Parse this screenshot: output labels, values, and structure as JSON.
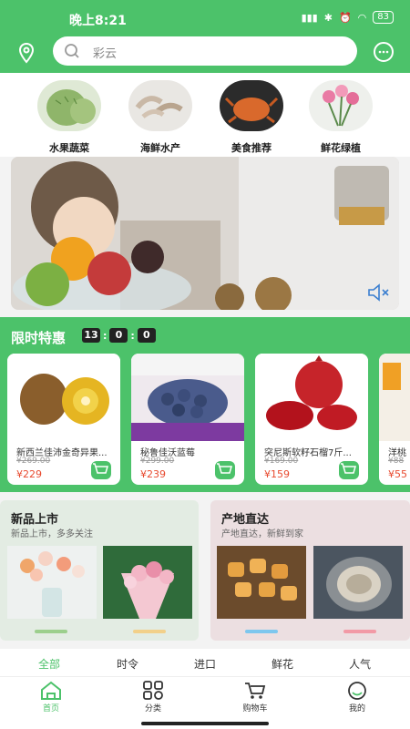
{
  "status_bar": {
    "time": "晚上8:21",
    "signal1": "ᵢₗ",
    "wifi": "≋",
    "battery": "83"
  },
  "search": {
    "placeholder": "彩云"
  },
  "categories": [
    {
      "label": "水果蔬菜",
      "icon": "custard-apple-image"
    },
    {
      "label": "海鲜水产",
      "icon": "shrimp-image"
    },
    {
      "label": "美食推荐",
      "icon": "crab-image"
    },
    {
      "label": "鲜花绿植",
      "icon": "flowers-image"
    }
  ],
  "flash_sale": {
    "title": "限时特惠",
    "timer": {
      "h": "13",
      "m": "0",
      "s": "0"
    },
    "products": [
      {
        "name": "新西兰佳沛金奇异果...",
        "old_price": "¥269.00",
        "price": "¥229"
      },
      {
        "name": "秘鲁佳沃蓝莓",
        "old_price": "¥299.00",
        "price": "¥239"
      },
      {
        "name": "突尼斯软籽石榴7斤...",
        "old_price": "¥169.00",
        "price": "¥159"
      },
      {
        "name": "洋桃",
        "old_price": "¥88",
        "price": "¥55"
      }
    ]
  },
  "sections": [
    {
      "title": "新品上市",
      "subtitle": "新品上市，多多关注"
    },
    {
      "title": "产地直达",
      "subtitle": "产地直达，新鲜到家"
    }
  ],
  "tabs": [
    "全部",
    "时令",
    "进口",
    "鲜花",
    "人气"
  ],
  "bottom_nav": [
    {
      "label": "首页",
      "icon": "home-icon",
      "active": true
    },
    {
      "label": "分类",
      "icon": "grid-icon",
      "active": false
    },
    {
      "label": "购物车",
      "icon": "cart-icon",
      "active": false
    },
    {
      "label": "我的",
      "icon": "profile-icon",
      "active": false
    }
  ],
  "colors": {
    "brand": "#4cc26a",
    "price": "#e84a2f"
  }
}
